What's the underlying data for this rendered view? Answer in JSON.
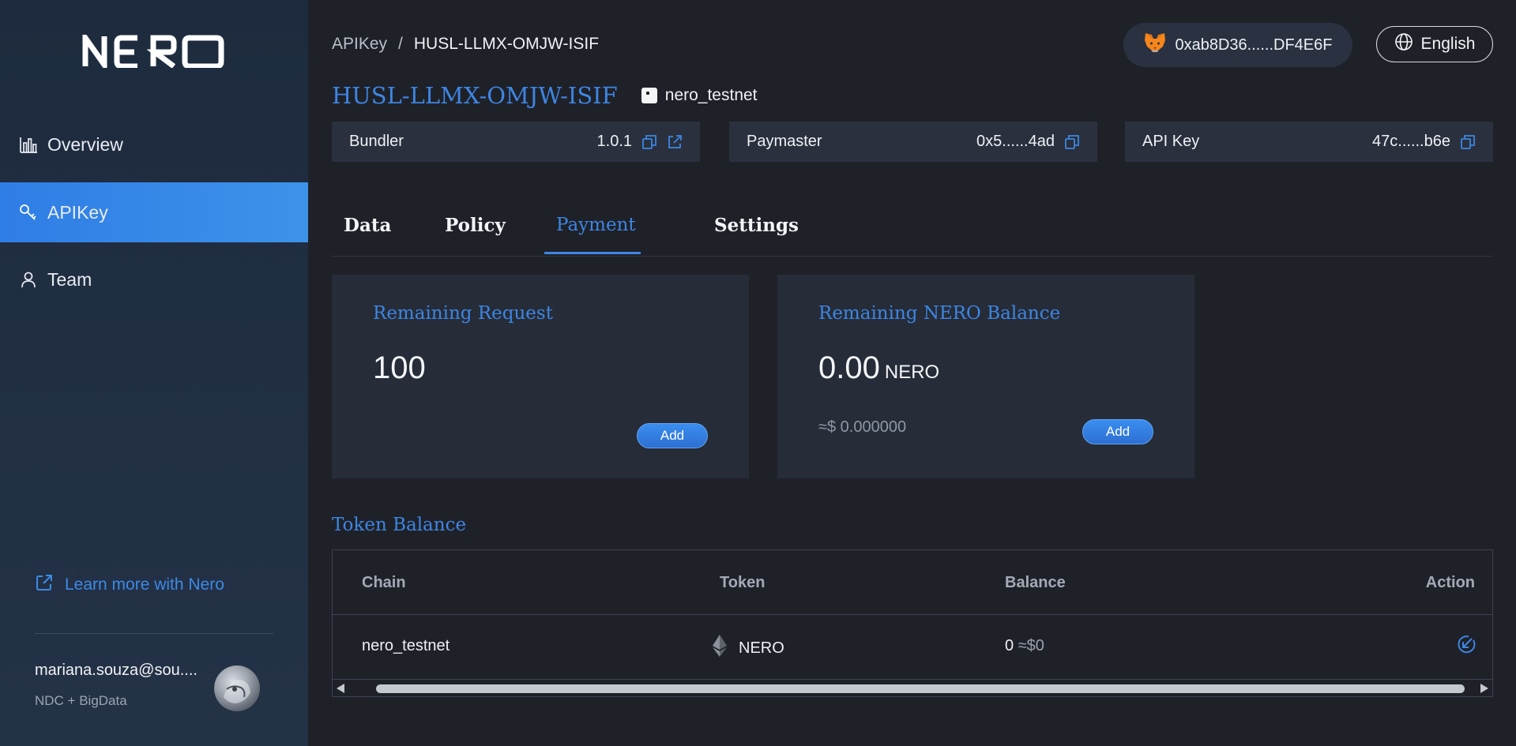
{
  "sidebar": {
    "logo_text": "NERO",
    "items": [
      {
        "label": "Overview",
        "icon": "bar-chart-icon"
      },
      {
        "label": "APIKey",
        "icon": "key-icon"
      },
      {
        "label": "Team",
        "icon": "person-icon"
      }
    ],
    "active_item": "APIKey",
    "learn_more": "Learn more with Nero",
    "user_email": "mariana.souza@sou....",
    "user_org": "NDC + BigData"
  },
  "header": {
    "breadcrumb": [
      "APIKey",
      "HUSL-LLMX-OMJW-ISIF"
    ],
    "breadcrumb_separator": "/",
    "wallet_address": "0xab8D36......DF4E6F",
    "language": "English"
  },
  "project": {
    "title": "HUSL-LLMX-OMJW-ISIF",
    "network": "nero_testnet"
  },
  "info_cards": {
    "bundler": {
      "label": "Bundler",
      "value": "1.0.1"
    },
    "paymaster": {
      "label": "Paymaster",
      "value": "0x5......4ad"
    },
    "api_key": {
      "label": "API Key",
      "value": "47c......b6e"
    }
  },
  "tabs": [
    "Data",
    "Policy",
    "Payment",
    "Settings"
  ],
  "active_tab": "Payment",
  "remaining_request": {
    "title": "Remaining Request",
    "value": "100",
    "button": "Add"
  },
  "remaining_balance": {
    "title": "Remaining NERO Balance",
    "value": "0.00",
    "unit": "NERO",
    "usd": "≈$ 0.000000",
    "button": "Add"
  },
  "token_balance": {
    "title": "Token Balance",
    "columns": [
      "Chain",
      "Token",
      "Balance",
      "Action"
    ],
    "rows": [
      {
        "chain": "nero_testnet",
        "token": "NERO",
        "balance": "0",
        "balance_usd": "≈$0"
      }
    ]
  },
  "colors": {
    "accent": "#3d86e3",
    "background": "#1f2129",
    "sidebar": "#1e2b3e",
    "card": "#262c38"
  }
}
